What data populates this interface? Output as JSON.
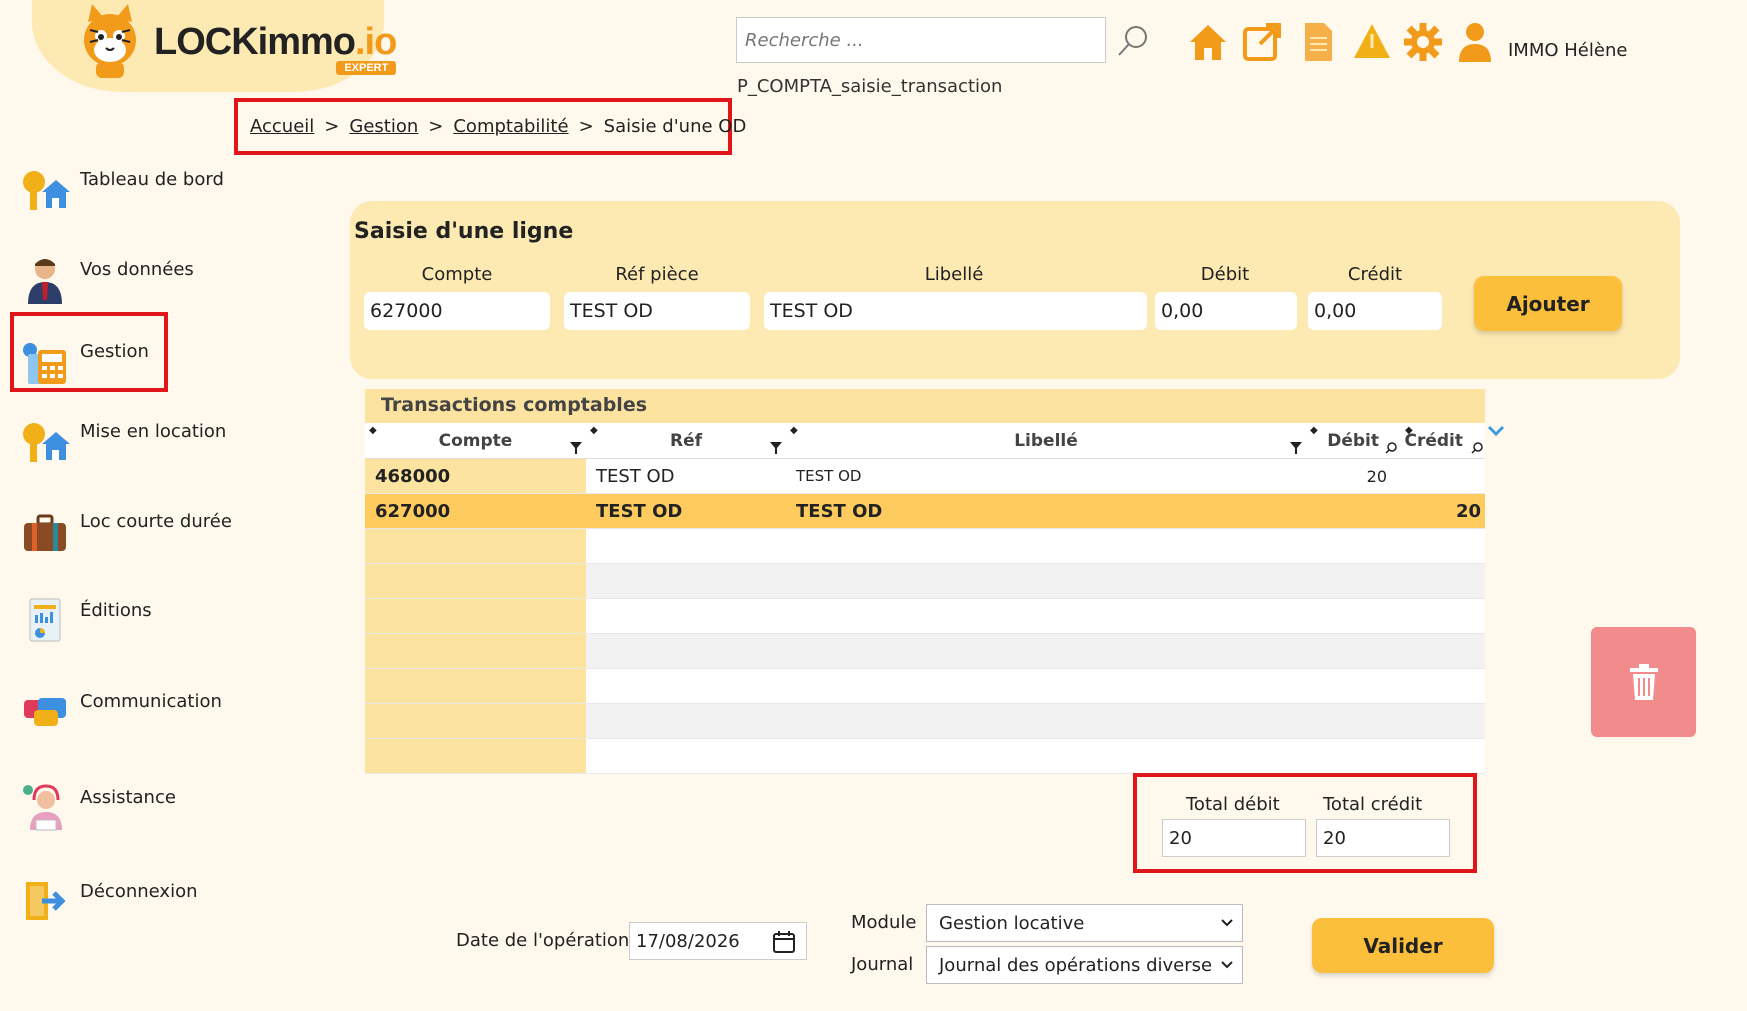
{
  "brand": {
    "name_main": "LOCKimmo",
    "name_suffix": ".io",
    "badge": "EXPERT"
  },
  "topbar": {
    "search_placeholder": "Recherche ...",
    "user_name": "IMMO Hélène",
    "page_code": "P_COMPTA_saisie_transaction",
    "icons": [
      "home-icon",
      "external-link-icon",
      "document-icon",
      "alert-icon",
      "gear-icon",
      "user-icon"
    ]
  },
  "breadcrumb": {
    "home": "Accueil",
    "gestion": "Gestion",
    "compta": "Comptabilité",
    "current": "Saisie d'une OD",
    "sep": ">"
  },
  "sidebar": {
    "items": [
      {
        "label": "Tableau de bord",
        "icon": "house-key-icon"
      },
      {
        "label": "Vos données",
        "icon": "person-icon"
      },
      {
        "label": "Gestion",
        "icon": "calculator-icon"
      },
      {
        "label": "Mise en location",
        "icon": "house-key-icon"
      },
      {
        "label": "Loc courte durée",
        "icon": "suitcase-icon"
      },
      {
        "label": "Éditions",
        "icon": "report-icon"
      },
      {
        "label": "Communication",
        "icon": "chat-icon"
      },
      {
        "label": "Assistance",
        "icon": "headset-icon"
      },
      {
        "label": "Déconnexion",
        "icon": "logout-icon"
      }
    ]
  },
  "saisie": {
    "title": "Saisie d'une ligne",
    "labels": {
      "compte": "Compte",
      "ref": "Réf pièce",
      "libelle": "Libellé",
      "debit": "Débit",
      "credit": "Crédit"
    },
    "values": {
      "compte": "627000",
      "ref": "TEST OD",
      "libelle": "TEST OD",
      "debit": "0,00",
      "credit": "0,00"
    },
    "add_button": "Ajouter"
  },
  "table": {
    "caption": "Transactions comptables",
    "columns": [
      "Compte",
      "Réf",
      "Libellé",
      "Débit",
      "Crédit"
    ],
    "rows": [
      {
        "compte": "468000",
        "ref": "TEST OD",
        "libelle": "TEST OD",
        "debit": "20",
        "credit": ""
      },
      {
        "compte": "627000",
        "ref": "TEST OD",
        "libelle": "TEST OD",
        "debit": "",
        "credit": "20"
      }
    ]
  },
  "totals": {
    "debit_label": "Total débit",
    "credit_label": "Total crédit",
    "debit": "20",
    "credit": "20"
  },
  "footer": {
    "date_label": "Date de l'opération",
    "date_value": "17/08/2026",
    "module_label": "Module",
    "module_value": "Gestion locative",
    "journal_label": "Journal",
    "journal_value": "Journal des opérations diverse",
    "validate_button": "Valider"
  },
  "colors": {
    "accent": "#fcbf3c",
    "panel": "#fde9b2",
    "highlight_border": "#e0161b",
    "delete": "#f28b8b"
  }
}
